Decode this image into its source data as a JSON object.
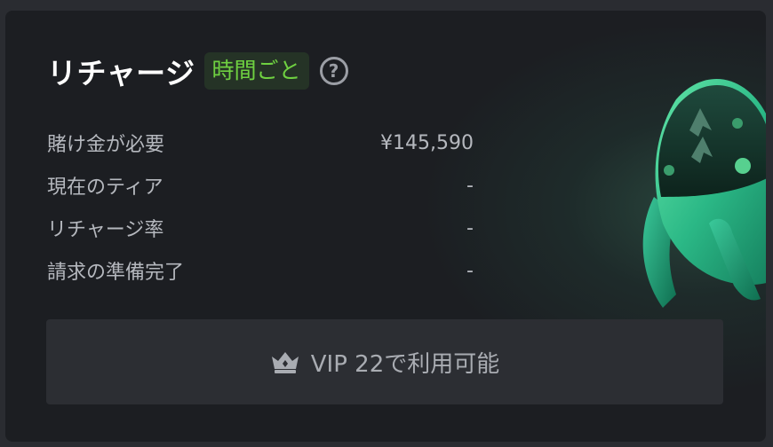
{
  "recharge": {
    "title": "リチャージ",
    "badge": "時間ごと",
    "help_icon": "question-circle-icon",
    "rows": [
      {
        "label": "賭け金が必要",
        "value": "¥145,590"
      },
      {
        "label": "現在のティア",
        "value": "-"
      },
      {
        "label": "リチャージ率",
        "value": "-"
      },
      {
        "label": "請求の準備完了",
        "value": "-"
      }
    ],
    "button": {
      "icon": "crown-icon",
      "label": "VIP 22で利用可能"
    }
  },
  "colors": {
    "background": "#1c1e22",
    "accent_green": "#6fd141",
    "badge_bg": "#253326",
    "button_bg": "#2c2e33"
  }
}
